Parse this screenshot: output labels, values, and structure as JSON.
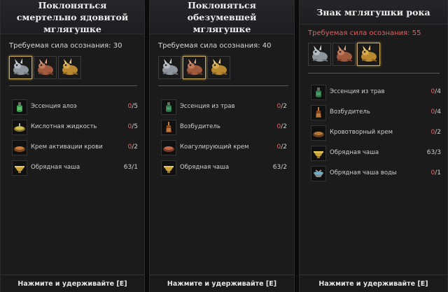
{
  "panels": [
    {
      "title": "Поклоняться смертельно ядовитой мглягушке",
      "requirement": "Требуемая сила осознания: 30",
      "forms": [
        "silver-frog-icon",
        "copper-frog-icon",
        "gold-frog-icon"
      ],
      "selected_form": 0,
      "ingredients": [
        {
          "icon": "aloe-essence-icon",
          "name": "Эссенция алоэ",
          "have": "0",
          "need": "/5"
        },
        {
          "icon": "acid-liquid-icon",
          "name": "Кислотная жидкость",
          "have": "0",
          "need": "/5"
        },
        {
          "icon": "blood-cream-icon",
          "name": "Крем активации крови",
          "have": "0",
          "need": "/2"
        },
        {
          "icon": "ritual-bowl-icon",
          "name": "Обрядная чаша",
          "have": "63",
          "need": "/1"
        }
      ],
      "footer": "Нажмите и удерживайте [E]"
    },
    {
      "title": "Поклоняться обезумевшей мглягушке",
      "requirement": "Требуемая сила осознания: 40",
      "forms": [
        "silver-frog-icon",
        "copper-frog-icon",
        "gold-frog-icon"
      ],
      "selected_form": 1,
      "ingredients": [
        {
          "icon": "herb-essence-icon",
          "name": "Эссенция из трав",
          "have": "0",
          "need": "/2"
        },
        {
          "icon": "stimulant-icon",
          "name": "Возбудитель",
          "have": "0",
          "need": "/2"
        },
        {
          "icon": "coagulant-cream-icon",
          "name": "Коагулирующий крем",
          "have": "0",
          "need": "/2"
        },
        {
          "icon": "ritual-bowl-icon",
          "name": "Обрядная чаша",
          "have": "63",
          "need": "/2"
        }
      ],
      "footer": "Нажмите и удерживайте [E]"
    },
    {
      "title": "Знак мглягушки рока",
      "requirement": "Требуемая сила осознания: 55",
      "forms": [
        "silver-frog-icon",
        "copper-frog-icon",
        "gold-frog-icon"
      ],
      "selected_form": 2,
      "ingredients": [
        {
          "icon": "herb-essence-icon",
          "name": "Эссенция из трав",
          "have": "0",
          "need": "/4"
        },
        {
          "icon": "stimulant-icon",
          "name": "Возбудитель",
          "have": "0",
          "need": "/4"
        },
        {
          "icon": "hematopoietic-cream-icon",
          "name": "Кровотворный крем",
          "have": "0",
          "need": "/2"
        },
        {
          "icon": "ritual-bowl-icon",
          "name": "Обрядная чаша",
          "have": "63",
          "need": "/3"
        },
        {
          "icon": "water-bowl-icon",
          "name": "Обрядная чаша воды",
          "have": "0",
          "need": "/1"
        }
      ],
      "footer": "Нажмите и удерживайте [E]"
    }
  ],
  "colors": {
    "insufficient": "#e06a6a",
    "requirement_unmet": "#e85d5d",
    "selected_border": "#c9a85a"
  }
}
